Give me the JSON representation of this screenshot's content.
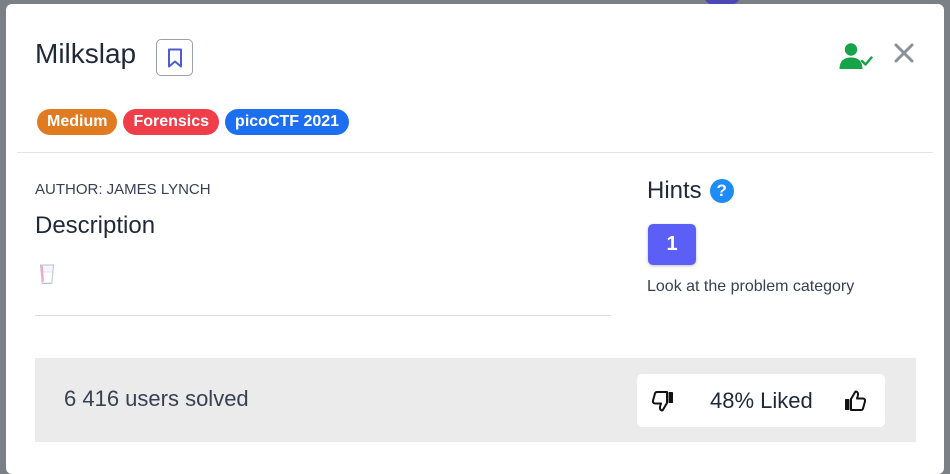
{
  "modal": {
    "title": "Milkslap"
  },
  "tags": [
    {
      "label": "Medium",
      "color": "#e07b22"
    },
    {
      "label": "Forensics",
      "color": "#ef3e4a"
    },
    {
      "label": "picoCTF 2021",
      "color": "#1d6ff2"
    }
  ],
  "author": "AUTHOR: JAMES LYNCH",
  "description": {
    "heading": "Description",
    "link_icon": "milk-glass-icon"
  },
  "hints": {
    "heading": "Hints",
    "help_icon_label": "?",
    "items": [
      {
        "number": "1",
        "text": "Look at the problem category"
      }
    ]
  },
  "footer": {
    "solved": "6 416 users solved",
    "liked": "48% Liked"
  },
  "colors": {
    "accent": "#5b5ff5",
    "solved_green": "#16a34a",
    "help_blue": "#1d8cf8"
  }
}
